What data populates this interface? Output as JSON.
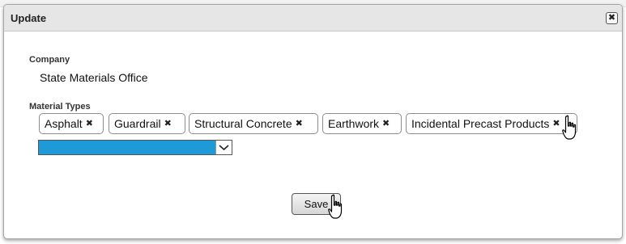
{
  "dialog": {
    "title": "Update",
    "close_glyph": "✖"
  },
  "company": {
    "label": "Company",
    "value": "State Materials Office"
  },
  "material_types": {
    "label": "Material Types",
    "tags": [
      {
        "label": "Asphalt"
      },
      {
        "label": "Guardrail"
      },
      {
        "label": "Structural Concrete"
      },
      {
        "label": "Earthwork"
      },
      {
        "label": "Incidental Precast Products"
      }
    ],
    "remove_glyph": "✖",
    "select_value": ""
  },
  "actions": {
    "save_label": "Save"
  },
  "colors": {
    "select_highlight": "#1e9ad8",
    "titlebar": "#e6e6e6"
  }
}
